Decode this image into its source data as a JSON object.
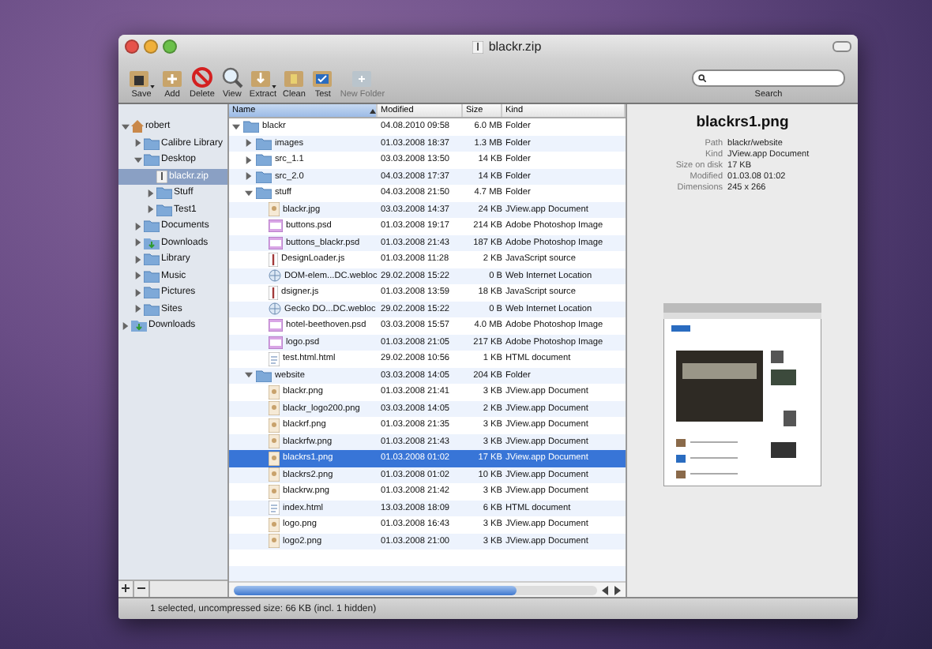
{
  "window": {
    "title": "blackr.zip"
  },
  "toolbar": [
    {
      "label": "Save",
      "kind": "save",
      "has_menu": true,
      "disabled": false
    },
    {
      "label": "Add",
      "kind": "add",
      "has_menu": false,
      "disabled": false
    },
    {
      "label": "Delete",
      "kind": "delete",
      "has_menu": false,
      "disabled": false
    },
    {
      "label": "View",
      "kind": "view",
      "has_menu": false,
      "disabled": false
    },
    {
      "label": "Extract",
      "kind": "extract",
      "has_menu": true,
      "disabled": false
    },
    {
      "label": "Clean",
      "kind": "clean",
      "has_menu": false,
      "disabled": false
    },
    {
      "label": "Test",
      "kind": "test",
      "has_menu": false,
      "disabled": false
    },
    {
      "label": "New Folder",
      "kind": "newfolder",
      "has_menu": false,
      "disabled": true
    }
  ],
  "search": {
    "label": "Search"
  },
  "sidebar": {
    "items": [
      {
        "label": "robert",
        "kind": "home",
        "expanded": true,
        "selected": false,
        "children": [
          {
            "label": "Calibre Library",
            "kind": "folder",
            "expanded": false,
            "selected": false
          },
          {
            "label": "Desktop",
            "kind": "folder",
            "expanded": true,
            "selected": false,
            "children": [
              {
                "label": "blackr.zip",
                "kind": "zip",
                "selected": true
              },
              {
                "label": "Stuff",
                "kind": "folder",
                "expanded": false,
                "selected": false
              },
              {
                "label": "Test1",
                "kind": "folder",
                "expanded": false,
                "selected": false
              }
            ]
          },
          {
            "label": "Documents",
            "kind": "folder",
            "expanded": false,
            "selected": false
          },
          {
            "label": "Downloads",
            "kind": "downloads",
            "expanded": false,
            "selected": false
          },
          {
            "label": "Library",
            "kind": "folder",
            "expanded": false,
            "selected": false
          },
          {
            "label": "Music",
            "kind": "folder",
            "expanded": false,
            "selected": false
          },
          {
            "label": "Pictures",
            "kind": "folder",
            "expanded": false,
            "selected": false
          },
          {
            "label": "Sites",
            "kind": "folder",
            "expanded": false,
            "selected": false
          }
        ]
      },
      {
        "label": "Downloads",
        "kind": "downloads",
        "expanded": false,
        "selected": false
      }
    ]
  },
  "table": {
    "columns": [
      {
        "label": "Name",
        "sorted": true
      },
      {
        "label": "Modified",
        "sorted": false
      },
      {
        "label": "Size",
        "sorted": false
      },
      {
        "label": "Kind",
        "sorted": false
      }
    ],
    "rows": [
      {
        "name": "blackr",
        "modified": "04.08.2010 09:58",
        "size": "6.0 MB",
        "type": "Folder",
        "kind": "folder",
        "expanded": true,
        "selected": false,
        "children": [
          {
            "name": "images",
            "modified": "01.03.2008 18:37",
            "size": "1.3 MB",
            "type": "Folder",
            "kind": "folder",
            "expanded": false,
            "selected": false
          },
          {
            "name": "src_1.1",
            "modified": "03.03.2008 13:50",
            "size": "14 KB",
            "type": "Folder",
            "kind": "folder",
            "expanded": false,
            "selected": false
          },
          {
            "name": "src_2.0",
            "modified": "04.03.2008 17:37",
            "size": "14 KB",
            "type": "Folder",
            "kind": "folder",
            "expanded": false,
            "selected": false
          },
          {
            "name": "stuff",
            "modified": "04.03.2008 21:50",
            "size": "4.7 MB",
            "type": "Folder",
            "kind": "folder",
            "expanded": true,
            "selected": false,
            "children": [
              {
                "name": "blackr.jpg",
                "modified": "03.03.2008 14:37",
                "size": "24 KB",
                "type": "JView.app Document",
                "kind": "image",
                "selected": false
              },
              {
                "name": "buttons.psd",
                "modified": "01.03.2008 19:17",
                "size": "214 KB",
                "type": "Adobe Photoshop Image",
                "kind": "psd",
                "selected": false
              },
              {
                "name": "buttons_blackr.psd",
                "modified": "01.03.2008 21:43",
                "size": "187 KB",
                "type": "Adobe Photoshop Image",
                "kind": "psd",
                "selected": false
              },
              {
                "name": "DesignLoader.js",
                "modified": "01.03.2008 11:28",
                "size": "2 KB",
                "type": "JavaScript source",
                "kind": "script",
                "selected": false
              },
              {
                "name": "DOM-elem...DC.webloc",
                "modified": "29.02.2008 15:22",
                "size": "0 B",
                "type": "Web Internet Location",
                "kind": "link",
                "selected": false
              },
              {
                "name": "dsigner.js",
                "modified": "01.03.2008 13:59",
                "size": "18 KB",
                "type": "JavaScript source",
                "kind": "script",
                "selected": false
              },
              {
                "name": "Gecko DO...DC.webloc",
                "modified": "29.02.2008 15:22",
                "size": "0 B",
                "type": "Web Internet Location",
                "kind": "link",
                "selected": false
              },
              {
                "name": "hotel-beethoven.psd",
                "modified": "03.03.2008 15:57",
                "size": "4.0 MB",
                "type": "Adobe Photoshop Image",
                "kind": "psd",
                "selected": false
              },
              {
                "name": "logo.psd",
                "modified": "01.03.2008 21:05",
                "size": "217 KB",
                "type": "Adobe Photoshop Image",
                "kind": "psd",
                "selected": false
              },
              {
                "name": "test.html.html",
                "modified": "29.02.2008 10:56",
                "size": "1 KB",
                "type": "HTML document",
                "kind": "html",
                "selected": false
              }
            ]
          },
          {
            "name": "website",
            "modified": "03.03.2008 14:05",
            "size": "204 KB",
            "type": "Folder",
            "kind": "folder",
            "expanded": true,
            "selected": false,
            "children": [
              {
                "name": "blackr.png",
                "modified": "01.03.2008 21:41",
                "size": "3 KB",
                "type": "JView.app Document",
                "kind": "image",
                "selected": false
              },
              {
                "name": "blackr_logo200.png",
                "modified": "03.03.2008 14:05",
                "size": "2 KB",
                "type": "JView.app Document",
                "kind": "image",
                "selected": false
              },
              {
                "name": "blackrf.png",
                "modified": "01.03.2008 21:35",
                "size": "3 KB",
                "type": "JView.app Document",
                "kind": "image",
                "selected": false
              },
              {
                "name": "blackrfw.png",
                "modified": "01.03.2008 21:43",
                "size": "3 KB",
                "type": "JView.app Document",
                "kind": "image",
                "selected": false
              },
              {
                "name": "blackrs1.png",
                "modified": "01.03.2008 01:02",
                "size": "17 KB",
                "type": "JView.app Document",
                "kind": "image",
                "selected": true
              },
              {
                "name": "blackrs2.png",
                "modified": "01.03.2008 01:02",
                "size": "10 KB",
                "type": "JView.app Document",
                "kind": "image",
                "selected": false
              },
              {
                "name": "blackrw.png",
                "modified": "01.03.2008 21:42",
                "size": "3 KB",
                "type": "JView.app Document",
                "kind": "image",
                "selected": false
              },
              {
                "name": "index.html",
                "modified": "13.03.2008 18:09",
                "size": "6 KB",
                "type": "HTML document",
                "kind": "html",
                "selected": false
              },
              {
                "name": "logo.png",
                "modified": "01.03.2008 16:43",
                "size": "3 KB",
                "type": "JView.app Document",
                "kind": "image",
                "selected": false
              },
              {
                "name": "logo2.png",
                "modified": "01.03.2008 21:00",
                "size": "3 KB",
                "type": "JView.app Document",
                "kind": "image",
                "selected": false
              }
            ]
          }
        ]
      }
    ]
  },
  "inspector": {
    "title": "blackrs1.png",
    "properties": [
      {
        "label": "Path",
        "value": "blackr/website"
      },
      {
        "label": "Kind",
        "value": "JView.app Document"
      },
      {
        "label": "Size on disk",
        "value": "17 KB"
      },
      {
        "label": "Modified",
        "value": "01.03.08 01:02"
      },
      {
        "label": "Dimensions",
        "value": "245 x 266"
      }
    ]
  },
  "status_bar": {
    "text": "1 selected, uncompressed size: 66 KB (incl. 1 hidden)"
  }
}
